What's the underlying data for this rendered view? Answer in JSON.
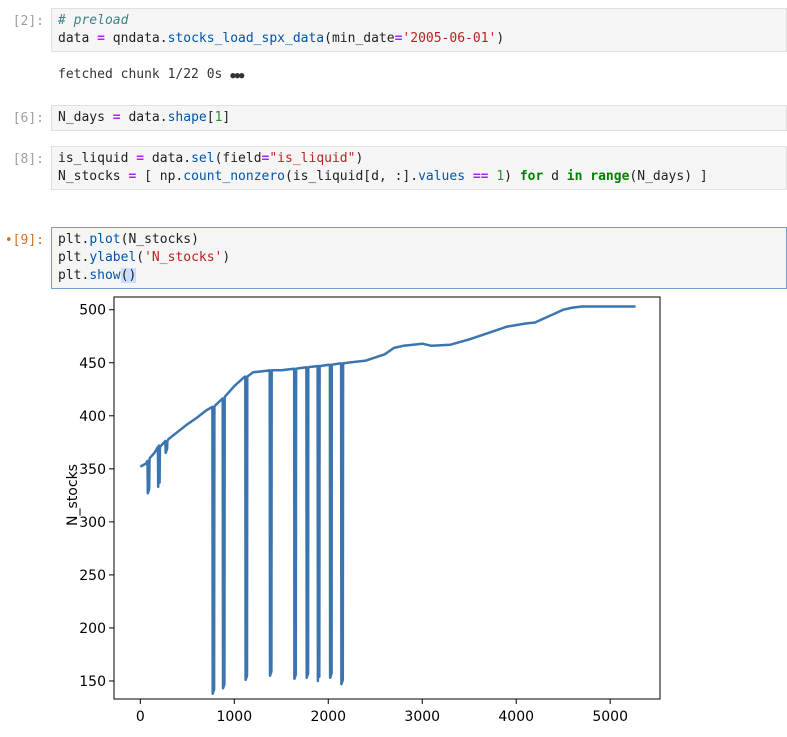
{
  "cells": [
    {
      "prompt": "[2]:",
      "lines": [
        [
          {
            "t": "comment",
            "v": "# preload"
          }
        ],
        [
          {
            "t": "var",
            "v": "data "
          },
          {
            "t": "op",
            "v": "="
          },
          {
            "t": "var",
            "v": " qndata."
          },
          {
            "t": "func",
            "v": "stocks_load_spx_data"
          },
          {
            "t": "var",
            "v": "(min_date"
          },
          {
            "t": "op",
            "v": "="
          },
          {
            "t": "str",
            "v": "'2005-06-01'"
          },
          {
            "t": "var",
            "v": ")"
          }
        ]
      ],
      "output": "fetched chunk 1/22 0s",
      "output_dots": "●●●"
    },
    {
      "prompt": "[6]:",
      "lines": [
        [
          {
            "t": "var",
            "v": "N_days "
          },
          {
            "t": "op",
            "v": "="
          },
          {
            "t": "var",
            "v": " data."
          },
          {
            "t": "func",
            "v": "shape"
          },
          {
            "t": "var",
            "v": "["
          },
          {
            "t": "num",
            "v": "1"
          },
          {
            "t": "var",
            "v": "]"
          }
        ]
      ]
    },
    {
      "prompt": "[8]:",
      "lines": [
        [
          {
            "t": "var",
            "v": "is_liquid "
          },
          {
            "t": "op",
            "v": "="
          },
          {
            "t": "var",
            "v": " data."
          },
          {
            "t": "func",
            "v": "sel"
          },
          {
            "t": "var",
            "v": "(field"
          },
          {
            "t": "op",
            "v": "="
          },
          {
            "t": "str",
            "v": "\"is_liquid\""
          },
          {
            "t": "var",
            "v": ")"
          }
        ],
        [
          {
            "t": "var",
            "v": "N_stocks "
          },
          {
            "t": "op",
            "v": "="
          },
          {
            "t": "var",
            "v": " [ np."
          },
          {
            "t": "func",
            "v": "count_nonzero"
          },
          {
            "t": "var",
            "v": "(is_liquid[d, :]."
          },
          {
            "t": "func",
            "v": "values"
          },
          {
            "t": "var",
            "v": " "
          },
          {
            "t": "op",
            "v": "=="
          },
          {
            "t": "var",
            "v": " "
          },
          {
            "t": "num",
            "v": "1"
          },
          {
            "t": "var",
            "v": ") "
          },
          {
            "t": "kw",
            "v": "for"
          },
          {
            "t": "var",
            "v": " d "
          },
          {
            "t": "kw",
            "v": "in"
          },
          {
            "t": "var",
            "v": " "
          },
          {
            "t": "kw",
            "v": "range"
          },
          {
            "t": "var",
            "v": "(N_days) ]"
          }
        ]
      ]
    },
    {
      "prompt": "[9]:",
      "prompt_marker": "•",
      "active": true,
      "lines": [
        [
          {
            "t": "var",
            "v": "plt."
          },
          {
            "t": "func",
            "v": "plot"
          },
          {
            "t": "var",
            "v": "(N_stocks)"
          }
        ],
        [
          {
            "t": "var",
            "v": "plt."
          },
          {
            "t": "func",
            "v": "ylabel"
          },
          {
            "t": "var",
            "v": "("
          },
          {
            "t": "str",
            "v": "'N_stocks'"
          },
          {
            "t": "var",
            "v": ")"
          }
        ],
        [
          {
            "t": "var",
            "v": "plt."
          },
          {
            "t": "func",
            "v": "show"
          },
          {
            "t": "hl",
            "v": "()"
          }
        ]
      ]
    }
  ],
  "colors": {
    "line": "#3b75af",
    "active_prompt": "#d0711b",
    "active_border": "#6f9fd8"
  },
  "chart_data": {
    "type": "line",
    "title": "",
    "xlabel": "",
    "ylabel": "N_stocks",
    "xlim": [
      -280,
      5530
    ],
    "ylim": [
      133,
      512
    ],
    "xticks": [
      0,
      1000,
      2000,
      3000,
      4000,
      5000
    ],
    "yticks": [
      150,
      200,
      250,
      300,
      350,
      400,
      450,
      500
    ],
    "trend": [
      [
        0,
        352
      ],
      [
        60,
        355
      ],
      [
        100,
        360
      ],
      [
        150,
        365
      ],
      [
        200,
        372
      ],
      [
        300,
        378
      ],
      [
        400,
        385
      ],
      [
        500,
        392
      ],
      [
        600,
        398
      ],
      [
        700,
        405
      ],
      [
        800,
        410
      ],
      [
        900,
        418
      ],
      [
        1000,
        428
      ],
      [
        1100,
        436
      ],
      [
        1200,
        441
      ],
      [
        1300,
        442
      ],
      [
        1400,
        443
      ],
      [
        1500,
        443
      ],
      [
        1600,
        444
      ],
      [
        1700,
        445
      ],
      [
        1800,
        446
      ],
      [
        1900,
        447
      ],
      [
        2000,
        448
      ],
      [
        2100,
        449
      ],
      [
        2200,
        450
      ],
      [
        2400,
        452
      ],
      [
        2600,
        458
      ],
      [
        2700,
        464
      ],
      [
        2800,
        466
      ],
      [
        2900,
        467
      ],
      [
        3000,
        468
      ],
      [
        3100,
        466
      ],
      [
        3300,
        467
      ],
      [
        3500,
        472
      ],
      [
        3700,
        478
      ],
      [
        3900,
        484
      ],
      [
        4100,
        487
      ],
      [
        4200,
        488
      ],
      [
        4300,
        492
      ],
      [
        4400,
        496
      ],
      [
        4500,
        500
      ],
      [
        4600,
        502
      ],
      [
        4700,
        503
      ],
      [
        4800,
        503
      ],
      [
        5000,
        503
      ],
      [
        5270,
        503
      ]
    ],
    "drops": [
      [
        80,
        327
      ],
      [
        190,
        333
      ],
      [
        270,
        365
      ],
      [
        770,
        138
      ],
      [
        880,
        143
      ],
      [
        1120,
        151
      ],
      [
        1380,
        155
      ],
      [
        1640,
        152
      ],
      [
        1770,
        153
      ],
      [
        1890,
        150
      ],
      [
        2020,
        153
      ],
      [
        2140,
        147
      ]
    ]
  }
}
